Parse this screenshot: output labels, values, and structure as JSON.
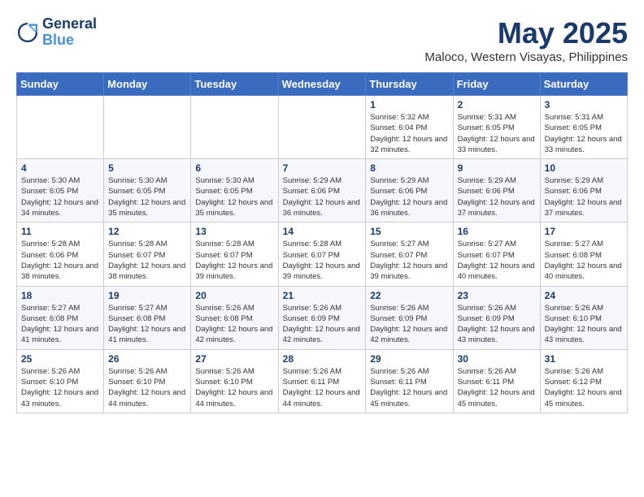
{
  "logo": {
    "text_general": "General",
    "text_blue": "Blue"
  },
  "title": "May 2025",
  "subtitle": "Maloco, Western Visayas, Philippines",
  "days_of_week": [
    "Sunday",
    "Monday",
    "Tuesday",
    "Wednesday",
    "Thursday",
    "Friday",
    "Saturday"
  ],
  "weeks": [
    [
      {
        "day": "",
        "info": ""
      },
      {
        "day": "",
        "info": ""
      },
      {
        "day": "",
        "info": ""
      },
      {
        "day": "",
        "info": ""
      },
      {
        "day": "1",
        "info": "Sunrise: 5:32 AM\nSunset: 6:04 PM\nDaylight: 12 hours and 32 minutes."
      },
      {
        "day": "2",
        "info": "Sunrise: 5:31 AM\nSunset: 6:05 PM\nDaylight: 12 hours and 33 minutes."
      },
      {
        "day": "3",
        "info": "Sunrise: 5:31 AM\nSunset: 6:05 PM\nDaylight: 12 hours and 33 minutes."
      }
    ],
    [
      {
        "day": "4",
        "info": "Sunrise: 5:30 AM\nSunset: 6:05 PM\nDaylight: 12 hours and 34 minutes."
      },
      {
        "day": "5",
        "info": "Sunrise: 5:30 AM\nSunset: 6:05 PM\nDaylight: 12 hours and 35 minutes."
      },
      {
        "day": "6",
        "info": "Sunrise: 5:30 AM\nSunset: 6:05 PM\nDaylight: 12 hours and 35 minutes."
      },
      {
        "day": "7",
        "info": "Sunrise: 5:29 AM\nSunset: 6:06 PM\nDaylight: 12 hours and 36 minutes."
      },
      {
        "day": "8",
        "info": "Sunrise: 5:29 AM\nSunset: 6:06 PM\nDaylight: 12 hours and 36 minutes."
      },
      {
        "day": "9",
        "info": "Sunrise: 5:29 AM\nSunset: 6:06 PM\nDaylight: 12 hours and 37 minutes."
      },
      {
        "day": "10",
        "info": "Sunrise: 5:29 AM\nSunset: 6:06 PM\nDaylight: 12 hours and 37 minutes."
      }
    ],
    [
      {
        "day": "11",
        "info": "Sunrise: 5:28 AM\nSunset: 6:06 PM\nDaylight: 12 hours and 38 minutes."
      },
      {
        "day": "12",
        "info": "Sunrise: 5:28 AM\nSunset: 6:07 PM\nDaylight: 12 hours and 38 minutes."
      },
      {
        "day": "13",
        "info": "Sunrise: 5:28 AM\nSunset: 6:07 PM\nDaylight: 12 hours and 39 minutes."
      },
      {
        "day": "14",
        "info": "Sunrise: 5:28 AM\nSunset: 6:07 PM\nDaylight: 12 hours and 39 minutes."
      },
      {
        "day": "15",
        "info": "Sunrise: 5:27 AM\nSunset: 6:07 PM\nDaylight: 12 hours and 39 minutes."
      },
      {
        "day": "16",
        "info": "Sunrise: 5:27 AM\nSunset: 6:07 PM\nDaylight: 12 hours and 40 minutes."
      },
      {
        "day": "17",
        "info": "Sunrise: 5:27 AM\nSunset: 6:08 PM\nDaylight: 12 hours and 40 minutes."
      }
    ],
    [
      {
        "day": "18",
        "info": "Sunrise: 5:27 AM\nSunset: 6:08 PM\nDaylight: 12 hours and 41 minutes."
      },
      {
        "day": "19",
        "info": "Sunrise: 5:27 AM\nSunset: 6:08 PM\nDaylight: 12 hours and 41 minutes."
      },
      {
        "day": "20",
        "info": "Sunrise: 5:26 AM\nSunset: 6:08 PM\nDaylight: 12 hours and 42 minutes."
      },
      {
        "day": "21",
        "info": "Sunrise: 5:26 AM\nSunset: 6:09 PM\nDaylight: 12 hours and 42 minutes."
      },
      {
        "day": "22",
        "info": "Sunrise: 5:26 AM\nSunset: 6:09 PM\nDaylight: 12 hours and 42 minutes."
      },
      {
        "day": "23",
        "info": "Sunrise: 5:26 AM\nSunset: 6:09 PM\nDaylight: 12 hours and 43 minutes."
      },
      {
        "day": "24",
        "info": "Sunrise: 5:26 AM\nSunset: 6:10 PM\nDaylight: 12 hours and 43 minutes."
      }
    ],
    [
      {
        "day": "25",
        "info": "Sunrise: 5:26 AM\nSunset: 6:10 PM\nDaylight: 12 hours and 43 minutes."
      },
      {
        "day": "26",
        "info": "Sunrise: 5:26 AM\nSunset: 6:10 PM\nDaylight: 12 hours and 44 minutes."
      },
      {
        "day": "27",
        "info": "Sunrise: 5:26 AM\nSunset: 6:10 PM\nDaylight: 12 hours and 44 minutes."
      },
      {
        "day": "28",
        "info": "Sunrise: 5:26 AM\nSunset: 6:11 PM\nDaylight: 12 hours and 44 minutes."
      },
      {
        "day": "29",
        "info": "Sunrise: 5:26 AM\nSunset: 6:11 PM\nDaylight: 12 hours and 45 minutes."
      },
      {
        "day": "30",
        "info": "Sunrise: 5:26 AM\nSunset: 6:11 PM\nDaylight: 12 hours and 45 minutes."
      },
      {
        "day": "31",
        "info": "Sunrise: 5:26 AM\nSunset: 6:12 PM\nDaylight: 12 hours and 45 minutes."
      }
    ]
  ]
}
